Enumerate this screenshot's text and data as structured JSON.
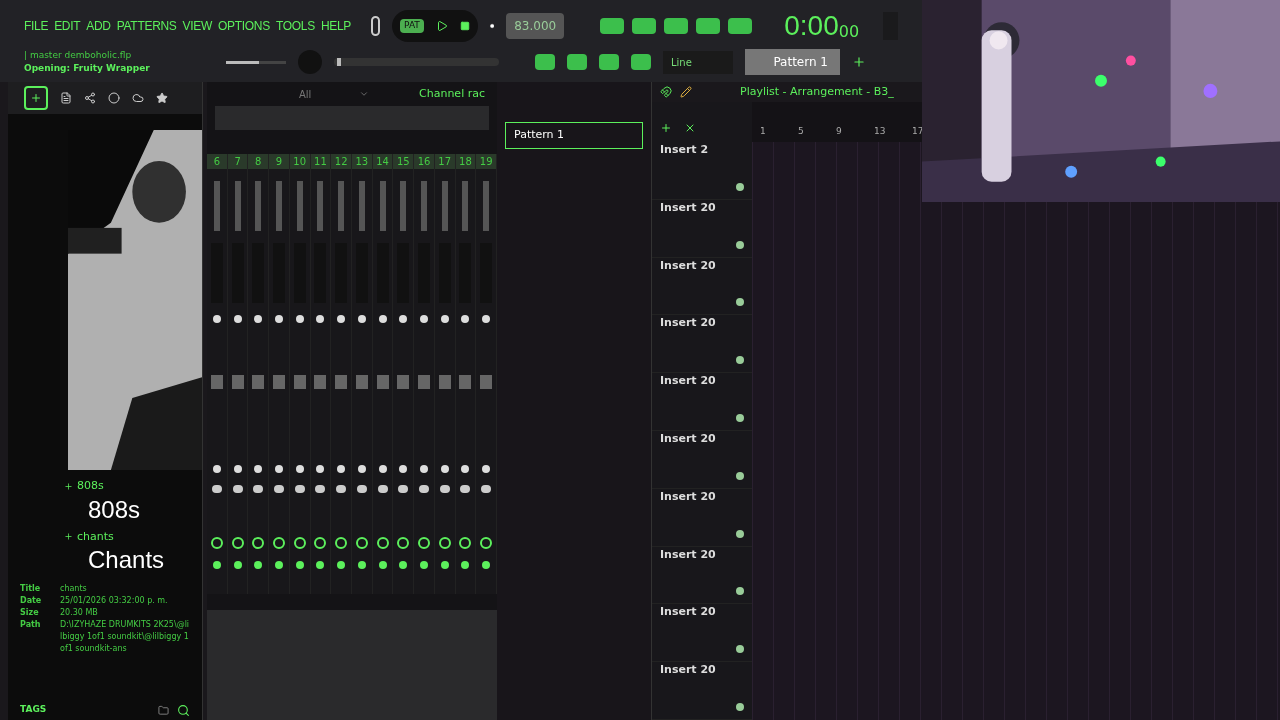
{
  "menu": [
    "FILE",
    "EDIT",
    "ADD",
    "PATTERNS",
    "VIEW",
    "OPTIONS",
    "TOOLS",
    "HELP"
  ],
  "transport": {
    "mode": "PAT",
    "tempo": "83.000",
    "time_main": "0:00",
    "time_small": "00"
  },
  "hint": {
    "file": "| master demboholic.flp",
    "status": "Opening: Fruity Wrapper"
  },
  "master_volume": {
    "level": 0.55
  },
  "song_position": {
    "level": 0.02
  },
  "snap": "Line",
  "pattern": "Pattern 1",
  "browser": {
    "items": [
      {
        "name": "808s",
        "label": "808s"
      },
      {
        "name": "chants",
        "label": "Chants"
      }
    ],
    "info": [
      {
        "key": "Title",
        "value": "chants"
      },
      {
        "key": "Date",
        "value": "25/01/2026 03:32:00 p. m."
      },
      {
        "key": "Size",
        "value": "20.30 MB"
      },
      {
        "key": "Path",
        "value": "D:\\IZYHAZE DRUMKITS 2K25\\@lilbiggy 1of1 soundkit\\@lilbiggy 1of1 soundkit-ans"
      }
    ],
    "tags": "TAGS"
  },
  "mixer": {
    "filter": "All",
    "channel_rack": "Channel rac",
    "channels": [
      "6",
      "7",
      "8",
      "9",
      "10",
      "11",
      "12",
      "13",
      "14",
      "15",
      "16",
      "17",
      "18",
      "19"
    ]
  },
  "patterns": [
    {
      "name": "Pattern 1",
      "selected": true
    }
  ],
  "playlist": {
    "title": "Playlist - Arrangement - B3_",
    "ruler": [
      "1",
      "5",
      "9",
      "13",
      "17"
    ],
    "tracks": [
      "Insert 2",
      "Insert 20",
      "Insert 20",
      "Insert 20",
      "Insert 20",
      "Insert 20",
      "Insert 20",
      "Insert 20",
      "Insert 20",
      "Insert 20"
    ]
  }
}
